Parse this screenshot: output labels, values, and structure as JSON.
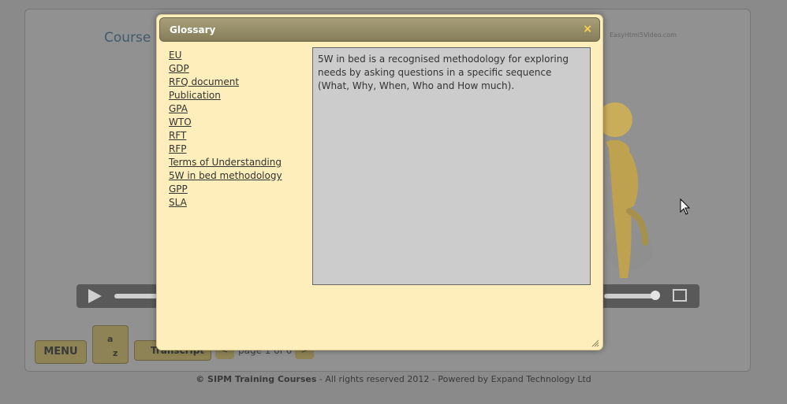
{
  "background": {
    "course_title": "Course I",
    "video_credit": "EasyHtml5Video.com",
    "controls": {
      "menu_label": "MENU",
      "az_top": "a",
      "az_bottom": "z",
      "transcript_label": "Transcript",
      "prev_label": "<",
      "page_info": "page 1 of 6",
      "next_label": ">"
    },
    "footer": {
      "brand": "© SIPM Training Courses",
      "rest": " - All rights reserved 2012 - Powered by Expand Technology Ltd"
    }
  },
  "glossary": {
    "title": "Glossary",
    "close_symbol": "×",
    "terms": [
      "EU",
      "GDP",
      "RFQ document",
      "Publication",
      "GPA",
      "WTO",
      "RFT",
      "RFP",
      "Terms of Understanding",
      "5W in bed methodology",
      "GPP",
      "SLA"
    ],
    "definition": "5W in bed is a recognised methodology for exploring needs by asking questions in a specific sequence (What, Why, When, Who and How much)."
  },
  "colors": {
    "modal_bg": "#fdeebb",
    "header_bg": "#857c59",
    "close_color": "#ffd54a",
    "definition_bg": "#cccccc"
  }
}
